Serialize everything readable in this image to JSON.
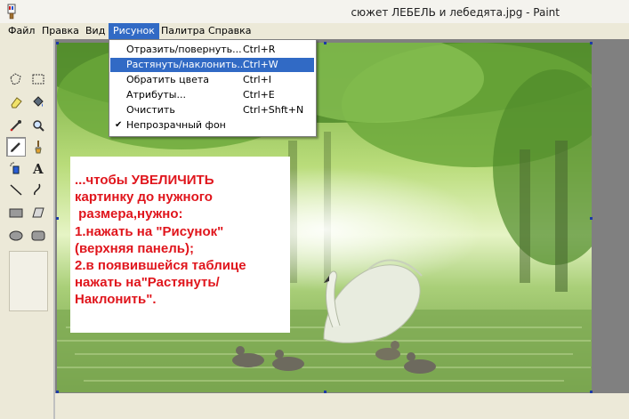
{
  "window": {
    "title": "сюжет ЛЕБЕЛЬ и лебедята.jpg - Paint"
  },
  "menubar": {
    "items": [
      {
        "label": "Файл"
      },
      {
        "label": "Правка"
      },
      {
        "label": "Вид"
      },
      {
        "label": "Рисунок",
        "active": true
      },
      {
        "label": "Палитра"
      },
      {
        "label": "Справка"
      }
    ]
  },
  "image_menu": {
    "items": [
      {
        "label": "Отразить/повернуть...",
        "shortcut": "Ctrl+R"
      },
      {
        "label": "Растянуть/наклонить...",
        "shortcut": "Ctrl+W",
        "highlighted": true
      },
      {
        "label": "Обратить цвета",
        "shortcut": "Ctrl+I"
      },
      {
        "label": "Атрибуты...",
        "shortcut": "Ctrl+E"
      },
      {
        "label": "Очистить",
        "shortcut": "Ctrl+Shft+N"
      },
      {
        "label": "Непрозрачный фон",
        "shortcut": "",
        "checked": true
      }
    ]
  },
  "toolbox": {
    "tools": [
      "free-select-icon",
      "rect-select-icon",
      "eraser-icon",
      "fill-bucket-icon",
      "eyedropper-icon",
      "magnifier-icon",
      "pencil-icon",
      "brush-icon",
      "airbrush-icon",
      "text-icon",
      "line-icon",
      "curve-icon",
      "rectangle-icon",
      "polygon-icon",
      "ellipse-icon",
      "rounded-rect-icon"
    ],
    "selected_tool": "pencil-icon"
  },
  "note": {
    "lines": [
      "...чтобы УВЕЛИЧИТЬ",
      "картинку до нужного",
      " размера,нужно:",
      "1.нажать на \"Рисунок\"",
      "(верхняя панель);",
      "2.в появившейся таблице",
      "нажать на\"Растянуть/",
      "Наклонить\"."
    ]
  },
  "colors": {
    "menu_highlight": "#316ac5",
    "note_text": "#e0151c",
    "workspace": "#808080"
  }
}
